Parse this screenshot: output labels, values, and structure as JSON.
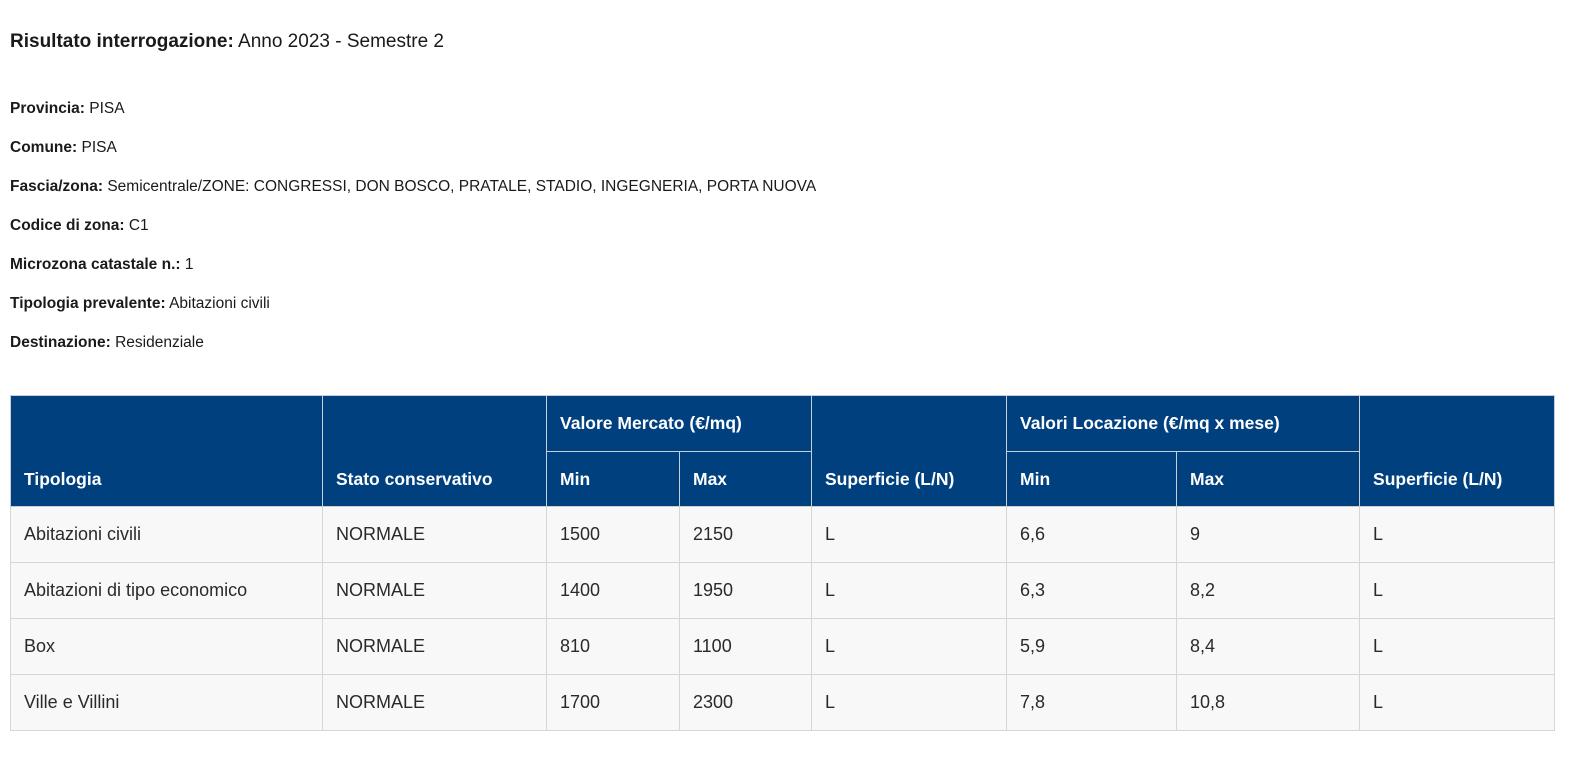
{
  "result": {
    "label": "Risultato interrogazione:",
    "value": "Anno 2023 - Semestre 2"
  },
  "meta": [
    {
      "key": "Provincia:",
      "value": "PISA"
    },
    {
      "key": "Comune:",
      "value": "PISA"
    },
    {
      "key": "Fascia/zona:",
      "value": "Semicentrale/ZONE: CONGRESSI, DON BOSCO, PRATALE, STADIO, INGEGNERIA, PORTA NUOVA"
    },
    {
      "key": "Codice di zona:",
      "value": "C1"
    },
    {
      "key": "Microzona catastale n.:",
      "value": "1"
    },
    {
      "key": "Tipologia prevalente:",
      "value": "Abitazioni civili"
    },
    {
      "key": "Destinazione:",
      "value": "Residenziale"
    }
  ],
  "table": {
    "headers": {
      "tipologia": "Tipologia",
      "stato": "Stato conservativo",
      "valore_mercato": "Valore Mercato (€/mq)",
      "vm_min": "Min",
      "vm_max": "Max",
      "superficie1": "Superficie (L/N)",
      "valori_locazione": "Valori Locazione (€/mq x mese)",
      "vl_min": "Min",
      "vl_max": "Max",
      "superficie2": "Superficie (L/N)"
    },
    "rows": [
      {
        "tipologia": "Abitazioni civili",
        "stato": "NORMALE",
        "vm_min": "1500",
        "vm_max": "2150",
        "sup1": "L",
        "vl_min": "6,6",
        "vl_max": "9",
        "sup2": "L"
      },
      {
        "tipologia": "Abitazioni di tipo economico",
        "stato": "NORMALE",
        "vm_min": "1400",
        "vm_max": "1950",
        "sup1": "L",
        "vl_min": "6,3",
        "vl_max": "8,2",
        "sup2": "L"
      },
      {
        "tipologia": "Box",
        "stato": "NORMALE",
        "vm_min": "810",
        "vm_max": "1100",
        "sup1": "L",
        "vl_min": "5,9",
        "vl_max": "8,4",
        "sup2": "L"
      },
      {
        "tipologia": "Ville e Villini",
        "stato": "NORMALE",
        "vm_min": "1700",
        "vm_max": "2300",
        "sup1": "L",
        "vl_min": "7,8",
        "vl_max": "10,8",
        "sup2": "L"
      }
    ]
  },
  "colors": {
    "header_bg": "#00407f",
    "header_text": "#ffffff",
    "cell_bg": "#f8f8f8"
  }
}
